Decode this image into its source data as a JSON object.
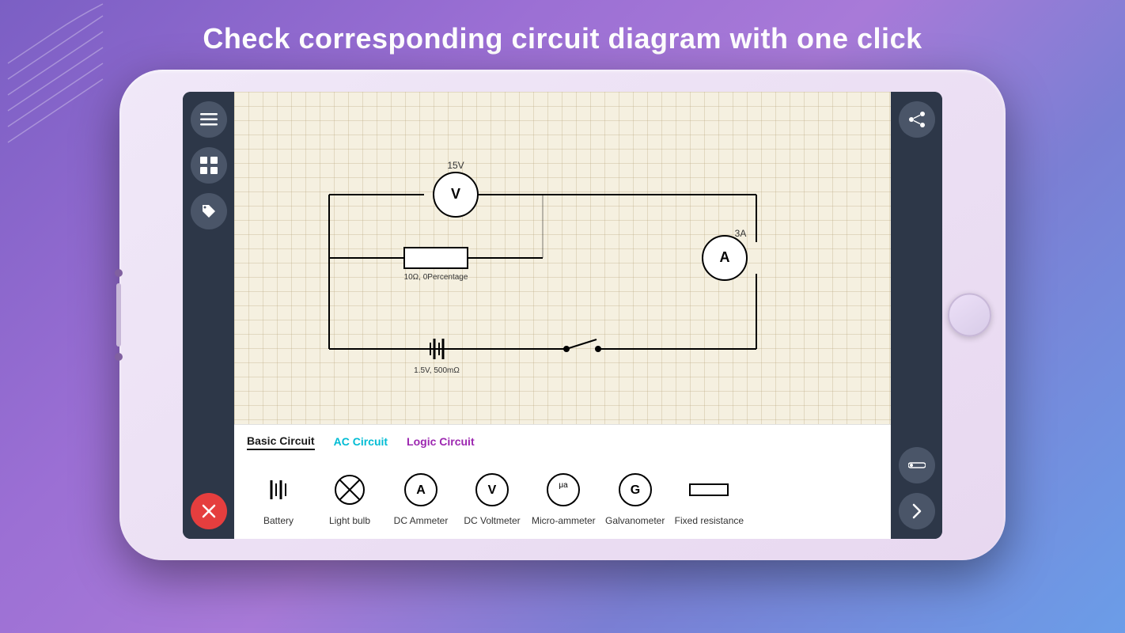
{
  "title": "Check corresponding circuit diagram with one click",
  "device": {
    "toolbar_left": {
      "buttons": [
        {
          "name": "menu",
          "icon": "☰"
        },
        {
          "name": "grid",
          "icon": "⊞"
        },
        {
          "name": "tag",
          "icon": "🏷"
        }
      ],
      "close_label": "✕"
    },
    "toolbar_right": {
      "share_icon": "share",
      "component_icon": "component",
      "next_icon": "›"
    }
  },
  "circuit": {
    "voltmeter_value": "15V",
    "ammeter_value": "3A",
    "resistor_label": "10Ω, 0Percentage",
    "battery_label": "1.5V, 500mΩ"
  },
  "tabs": [
    {
      "label": "Basic Circuit",
      "style": "active"
    },
    {
      "label": "AC Circuit",
      "style": "cyan"
    },
    {
      "label": "Logic Circuit",
      "style": "purple"
    }
  ],
  "components": [
    {
      "name": "battery",
      "label": "Battery"
    },
    {
      "name": "light-bulb",
      "label": "Light bulb"
    },
    {
      "name": "dc-ammeter",
      "label": "DC Ammeter"
    },
    {
      "name": "dc-voltmeter",
      "label": "DC Voltmeter"
    },
    {
      "name": "micro-ammeter",
      "label": "Micro-ammeter"
    },
    {
      "name": "galvanometer",
      "label": "Galvanometer"
    },
    {
      "name": "fixed-resistance",
      "label": "Fixed resistance"
    }
  ]
}
